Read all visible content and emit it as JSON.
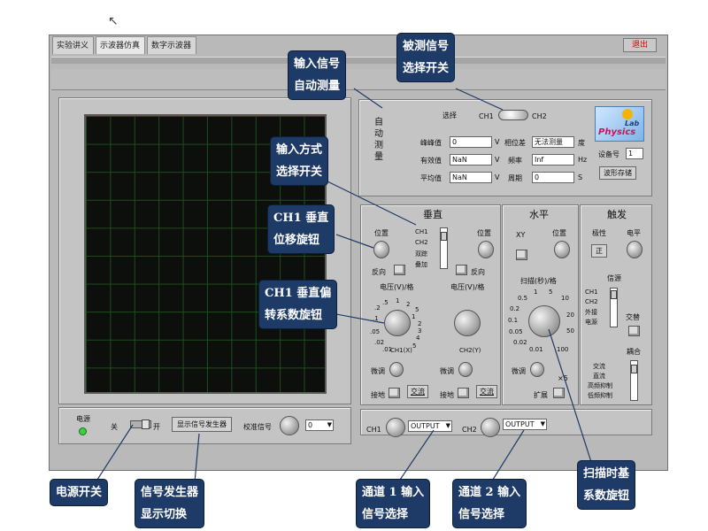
{
  "cursor_glyph": "↖",
  "tabs": [
    {
      "label": "实验讲义"
    },
    {
      "label": "示波器仿真"
    },
    {
      "label": "数字示波器"
    }
  ],
  "exit_label": "退出",
  "auto_measure": {
    "side_label": "自动测量",
    "select_label": "选择",
    "ch1": "CH1",
    "ch2": "CH2",
    "rows": [
      {
        "label": "峰峰值",
        "value": "0",
        "unit": "V"
      },
      {
        "label": "有效值",
        "value": "NaN",
        "unit": "V"
      },
      {
        "label": "平均值",
        "value": "NaN",
        "unit": "V"
      }
    ],
    "right_rows": [
      {
        "label": "相位差",
        "value": "无法测量",
        "unit": "度"
      },
      {
        "label": "频率",
        "value": "Inf",
        "unit": "Hz"
      },
      {
        "label": "周期",
        "value": "0",
        "unit": "S"
      }
    ]
  },
  "logo": {
    "line1": "Lab",
    "line2": "Physics"
  },
  "device_label": "设备号",
  "device_value": "1",
  "save_waveform": "波形存储",
  "vertical": {
    "title": "垂直",
    "pos": "位置",
    "reverse": "反向",
    "modes": [
      "CH1",
      "CH2",
      "双踪",
      "叠加"
    ],
    "volt_div": "电压(V)/格",
    "ch1_knob_label": "CH1(X)",
    "ch2_knob_label": "CH2(Y)",
    "fine": "微调",
    "ground": "接地",
    "ac": "交流",
    "ticks_left": [
      ".5",
      "1",
      "2",
      ".2",
      "5",
      ".1",
      ".05",
      ".02",
      ".01",
      "1",
      "2",
      "3",
      "4",
      "5"
    ]
  },
  "horizontal": {
    "title": "水平",
    "xy": "XY",
    "pos": "位置",
    "sweep": "扫描(秒)/格",
    "ticks": [
      "0.5",
      "1",
      "5",
      "10",
      "0.2",
      "0.1",
      "50",
      "20",
      "0.05",
      "0.02",
      "0.01",
      "100"
    ],
    "fine": "微调",
    "expand": "扩展",
    "x5": "×5"
  },
  "trigger": {
    "title": "触发",
    "polarity": "极性",
    "level": "电平",
    "positive": "正",
    "source": "信源",
    "sources": [
      "CH1",
      "CH2",
      "外接",
      "电源"
    ],
    "alternate": "交替",
    "coupling": "耦合",
    "couplings": [
      "交流",
      "直流",
      "高频抑制",
      "低频抑制"
    ]
  },
  "bottom": {
    "power": "电源",
    "off": "关",
    "on": "开",
    "signal_gen_btn": "显示信号发生器",
    "calib": "校准信号",
    "calib_value": "0",
    "ch1": "CH1",
    "ch2": "CH2",
    "output1": "OUTPUT",
    "output2": "OUTPUT"
  },
  "callouts": {
    "input_auto": [
      "输入信号",
      "自动测量"
    ],
    "measured_select": [
      "被测信号",
      "选择开关"
    ],
    "input_mode": [
      "输入方式",
      "选择开关"
    ],
    "ch1_vpos": [
      "CH1 垂直",
      "位移旋钮"
    ],
    "ch1_vdef": [
      "CH1 垂直偏",
      "转系数旋钮"
    ],
    "power_switch": [
      "电源开关"
    ],
    "siggen": [
      "信号发生器",
      "显示切换"
    ],
    "ch1_input": [
      "通道 1 输入",
      "信号选择"
    ],
    "ch2_input": [
      "通道 2 输入",
      "信号选择"
    ],
    "timebase": [
      "扫描时基",
      "系数旋钮"
    ]
  },
  "colors": {
    "callout_bg": "#1e3a66",
    "panel": "#c4c4c4",
    "screen": "#0c0f0c",
    "grid": "#1d4e1d"
  }
}
